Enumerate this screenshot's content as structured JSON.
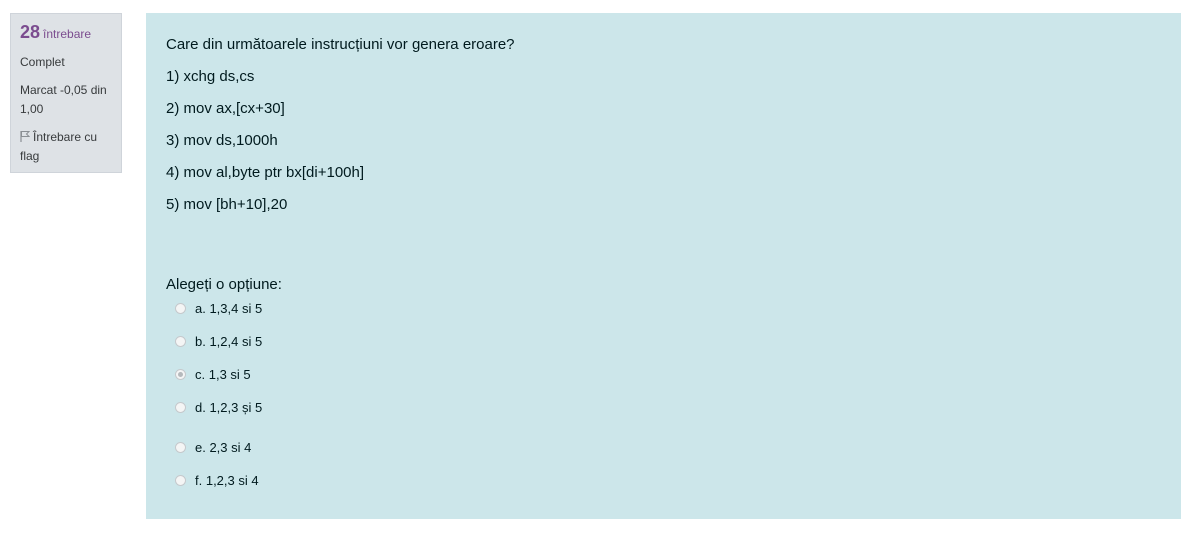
{
  "info": {
    "number": "28",
    "number_label": "întrebare",
    "state": "Complet",
    "grade": "Marcat -0,05 din 1,00",
    "flag_label": "Întrebare cu flag"
  },
  "question": {
    "lines": [
      "Care din următoarele instrucțiuni vor genera eroare?",
      "1) xchg ds,cs",
      "2) mov ax,[cx+30]",
      "3) mov ds,1000h",
      "4) mov al,byte ptr bx[di+100h]",
      "5) mov [bh+10],20"
    ],
    "prompt": "Alegeți o opțiune:",
    "options": [
      {
        "label": "a. 1,3,4 si 5",
        "checked": false
      },
      {
        "label": "b. 1,2,4 si 5",
        "checked": false
      },
      {
        "label": "c. 1,3 si 5",
        "checked": true
      },
      {
        "label": "d. 1,2,3 și 5",
        "checked": false
      },
      {
        "label": "e. 2,3 si 4",
        "checked": false
      },
      {
        "label": "f. 1,2,3 si 4",
        "checked": false
      }
    ]
  },
  "colors": {
    "content_background": "#cce6ea",
    "info_background": "#dee2e6",
    "question_number": "#7b4c8f"
  },
  "icons": {
    "flag": "flag-icon"
  }
}
